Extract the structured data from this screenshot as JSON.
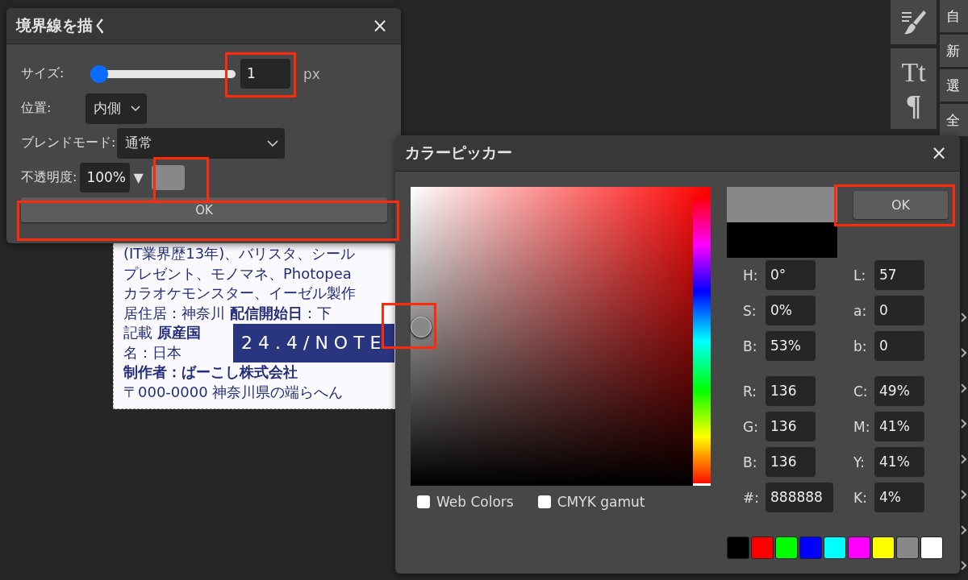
{
  "stroke_dialog": {
    "title": "境界線を描く",
    "close": "×",
    "size": {
      "label": "サイズ:",
      "level": 0,
      "value": "1",
      "unit": "px"
    },
    "position": {
      "label": "位置:",
      "value": "内側"
    },
    "blend_mode": {
      "label": "ブレンドモード:",
      "value": "通常"
    },
    "opacity": {
      "label": "不透明度:",
      "value": "100%",
      "arrow": "▼",
      "color": "#888888"
    },
    "ok": "OK"
  },
  "document": {
    "lines": [
      "(IT業界歴13年)、バリスタ、シール",
      "プレゼント、モノマネ、Photopea",
      "カラオケモンスター、イーゼル製作",
      "居住居：神奈川 **配信開始日**：下",
      "記載 **原産国**",
      "名：日本",
      "**制作者：ばーこし株式会社**",
      "〒000-0000 神奈川県の端らへん"
    ],
    "banner": "24.4/NOTE"
  },
  "color_picker": {
    "title": "カラーピッカー",
    "close": "×",
    "previews": [
      {
        "color": "#888888"
      },
      {
        "color": "#000000"
      }
    ],
    "ok": "OK",
    "hue_slider": {
      "level": 0
    },
    "fields_left": [
      {
        "label": "H:",
        "value": "0°"
      },
      {
        "label": "S:",
        "value": "0%"
      },
      {
        "label": "B:",
        "value": "53%"
      },
      {
        "label": "R:",
        "value": "136"
      },
      {
        "label": "G:",
        "value": "136"
      },
      {
        "label": "B:",
        "value": "136"
      },
      {
        "label": "#:",
        "value": "888888"
      }
    ],
    "fields_right": [
      {
        "label": "L:",
        "value": "57"
      },
      {
        "label": "a:",
        "value": "0"
      },
      {
        "label": "b:",
        "value": "0"
      },
      {
        "label": "C:",
        "value": "49%"
      },
      {
        "label": "M:",
        "value": "41%"
      },
      {
        "label": "Y:",
        "value": "41%"
      },
      {
        "label": "K:",
        "value": "4%"
      }
    ],
    "options": [
      {
        "label": "Web Colors",
        "checked": false
      },
      {
        "label": "CMYK gamut",
        "checked": false
      }
    ],
    "swatches": [
      {
        "color": "#000000"
      },
      {
        "color": "#ff0000"
      },
      {
        "color": "#00ff00"
      },
      {
        "color": "#0000ff"
      },
      {
        "color": "#00ffff"
      },
      {
        "color": "#ff00ff"
      },
      {
        "color": "#ffff00"
      },
      {
        "color": "#888888"
      },
      {
        "color": "#ffffff"
      }
    ]
  },
  "right_panel": {
    "tools": [
      "Tt",
      "¶"
    ],
    "menu_items": [
      "自",
      "新",
      "選",
      "全"
    ]
  }
}
